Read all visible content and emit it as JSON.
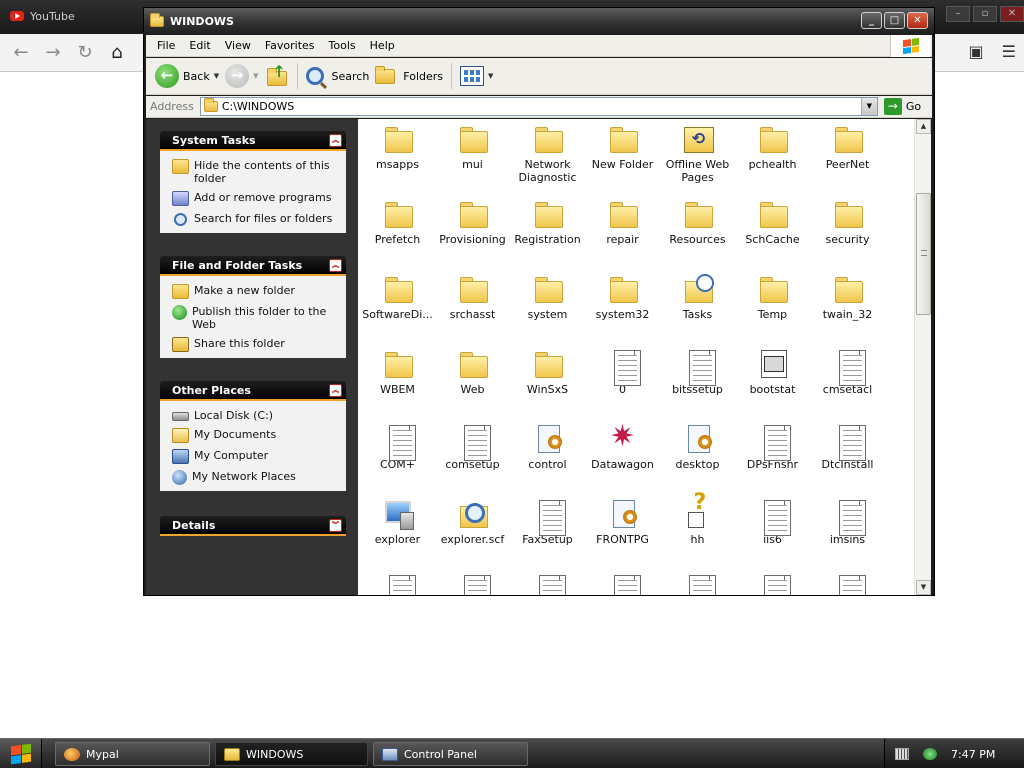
{
  "background_browser": {
    "tab_title": "YouTube"
  },
  "window": {
    "title": "WINDOWS"
  },
  "menu": [
    "File",
    "Edit",
    "View",
    "Favorites",
    "Tools",
    "Help"
  ],
  "toolbar": {
    "back_label": "Back",
    "search_label": "Search",
    "folders_label": "Folders"
  },
  "address": {
    "label": "Address",
    "path": "C:\\WINDOWS",
    "go_label": "Go"
  },
  "taskpane": {
    "system_tasks": {
      "title": "System Tasks",
      "items": [
        "Hide the contents of this folder",
        "Add or remove programs",
        "Search for files or folders"
      ]
    },
    "file_folder_tasks": {
      "title": "File and Folder Tasks",
      "items": [
        "Make a new folder",
        "Publish this folder to the Web",
        "Share this folder"
      ]
    },
    "other_places": {
      "title": "Other Places",
      "items": [
        "Local Disk (C:)",
        "My Documents",
        "My Computer",
        "My Network Places"
      ]
    },
    "details": {
      "title": "Details"
    }
  },
  "files": [
    {
      "name": "msapps",
      "icon": "folder-icon"
    },
    {
      "name": "mui",
      "icon": "folder-icon"
    },
    {
      "name": "Network Diagnostic",
      "icon": "folder-icon"
    },
    {
      "name": "New Folder",
      "icon": "folder-icon"
    },
    {
      "name": "Offline Web Pages",
      "icon": "offline-web-pages-icon"
    },
    {
      "name": "pchealth",
      "icon": "folder-icon"
    },
    {
      "name": "PeerNet",
      "icon": "folder-icon"
    },
    {
      "name": "Prefetch",
      "icon": "folder-icon"
    },
    {
      "name": "Provisioning",
      "icon": "folder-icon"
    },
    {
      "name": "Registration",
      "icon": "folder-icon"
    },
    {
      "name": "repair",
      "icon": "folder-icon"
    },
    {
      "name": "Resources",
      "icon": "folder-icon"
    },
    {
      "name": "SchCache",
      "icon": "folder-icon"
    },
    {
      "name": "security",
      "icon": "folder-icon"
    },
    {
      "name": "SoftwareDi...",
      "icon": "folder-icon"
    },
    {
      "name": "srchasst",
      "icon": "folder-icon"
    },
    {
      "name": "system",
      "icon": "folder-icon"
    },
    {
      "name": "system32",
      "icon": "folder-icon"
    },
    {
      "name": "Tasks",
      "icon": "scheduled-tasks-icon"
    },
    {
      "name": "Temp",
      "icon": "folder-icon"
    },
    {
      "name": "twain_32",
      "icon": "folder-icon"
    },
    {
      "name": "WBEM",
      "icon": "folder-icon"
    },
    {
      "name": "Web",
      "icon": "folder-icon"
    },
    {
      "name": "WinSxS",
      "icon": "folder-icon"
    },
    {
      "name": "0",
      "icon": "text-file-icon"
    },
    {
      "name": "bitssetup",
      "icon": "text-file-icon"
    },
    {
      "name": "bootstat",
      "icon": "dat-file-icon"
    },
    {
      "name": "cmsetacl",
      "icon": "text-file-icon"
    },
    {
      "name": "COM+",
      "icon": "text-file-icon"
    },
    {
      "name": "comsetup",
      "icon": "text-file-icon"
    },
    {
      "name": "control",
      "icon": "settings-file-icon"
    },
    {
      "name": "Datawagon",
      "icon": "datawagon-icon"
    },
    {
      "name": "desktop",
      "icon": "settings-file-icon"
    },
    {
      "name": "DPsFnshr",
      "icon": "text-file-icon"
    },
    {
      "name": "DtcInstall",
      "icon": "text-file-icon"
    },
    {
      "name": "explorer",
      "icon": "explorer-app-icon"
    },
    {
      "name": "explorer.scf",
      "icon": "explorer-scf-icon"
    },
    {
      "name": "FaxSetup",
      "icon": "text-file-icon"
    },
    {
      "name": "FRONTPG",
      "icon": "settings-file-icon"
    },
    {
      "name": "hh",
      "icon": "help-icon"
    },
    {
      "name": "iis6",
      "icon": "text-file-icon"
    },
    {
      "name": "imsins",
      "icon": "text-file-icon"
    },
    {
      "name": "",
      "icon": "text-file-icon"
    },
    {
      "name": "",
      "icon": "text-file-icon"
    },
    {
      "name": "",
      "icon": "text-file-icon"
    },
    {
      "name": "",
      "icon": "text-file-icon"
    },
    {
      "name": "",
      "icon": "text-file-icon"
    },
    {
      "name": "",
      "icon": "text-file-icon"
    },
    {
      "name": "",
      "icon": "text-file-icon"
    }
  ],
  "taskbar": {
    "buttons": [
      "Mypal",
      "WINDOWS",
      "Control Panel"
    ],
    "clock": "7:47 PM"
  }
}
